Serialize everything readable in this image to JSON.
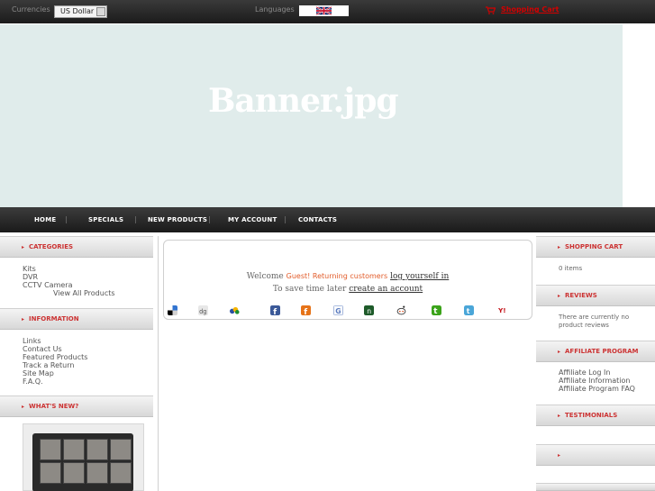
{
  "topbar": {
    "currency_label": "Currencies",
    "currency_value": "US Dollar",
    "languages_label": "Languages",
    "cart_label": "Shopping Cart",
    "accent_color": "#d40000"
  },
  "banner": {
    "text": "Banner.jpg"
  },
  "nav": {
    "items": [
      "HOME",
      "SPECIALS",
      "NEW PRODUCTS",
      "MY ACCOUNT",
      "CONTACTS"
    ]
  },
  "left": {
    "categories": {
      "title": "CATEGORIES",
      "items": [
        "Kits",
        "DVR",
        "CCTV Camera"
      ],
      "view_all": "View All Products"
    },
    "information": {
      "title": "INFORMATION",
      "items": [
        "Links",
        "Contact Us",
        "Featured Products",
        "Track a Return",
        "Site Map",
        "F.A.Q."
      ]
    },
    "whats_new": {
      "title": "WHAT'S NEW?"
    }
  },
  "center": {
    "welcome_prefix": "Welcome",
    "guest_text": "Guest! Returning customers",
    "login_link": "log yourself in",
    "later_text": "To save time later",
    "create_link": "create an account",
    "social_icons": [
      "delicious-icon",
      "digg-icon",
      "myspace-icon",
      "facebook-icon",
      "fark-icon",
      "google-icon",
      "newsvine-icon",
      "reddit-icon",
      "technorati-icon",
      "twitter-icon",
      "yahoo-icon"
    ]
  },
  "right": {
    "shopping_cart": {
      "title": "SHOPPING CART",
      "text": "0 items"
    },
    "reviews": {
      "title": "REVIEWS",
      "text_line1": "There are currently no",
      "text_line2": "product reviews"
    },
    "affiliate": {
      "title": "AFFILIATE PROGRAM",
      "items": [
        "Affiliate Log In",
        "Affiliate Information",
        "Affiliate Program FAQ"
      ]
    },
    "testimonials": {
      "title": "TESTIMONIALS"
    }
  }
}
